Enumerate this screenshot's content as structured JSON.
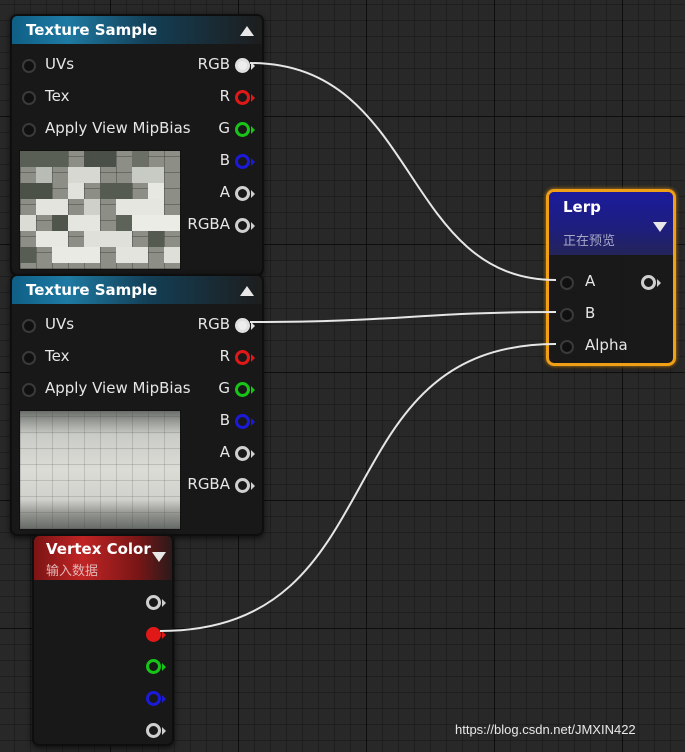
{
  "texture_sample_1": {
    "title": "Texture Sample",
    "inputs": [
      "UVs",
      "Tex",
      "Apply View MipBias"
    ],
    "outputs": [
      "RGB",
      "R",
      "G",
      "B",
      "A",
      "RGBA"
    ]
  },
  "texture_sample_2": {
    "title": "Texture Sample",
    "inputs": [
      "UVs",
      "Tex",
      "Apply View MipBias"
    ],
    "outputs": [
      "RGB",
      "R",
      "G",
      "B",
      "A",
      "RGBA"
    ]
  },
  "vertex_color": {
    "title": "Vertex Color",
    "subtitle": "输入数据"
  },
  "lerp": {
    "title": "Lerp",
    "subtitle": "正在预览",
    "inputs": [
      "A",
      "B",
      "Alpha"
    ]
  },
  "colors": {
    "pin_white": "#e0e0e0",
    "pin_red": "#e01818",
    "pin_green": "#18c418",
    "pin_blue": "#1a1ad8",
    "pin_gray": "#cfcfcf",
    "selection_orange": "#f0a017",
    "wire": "#e6e6e6"
  },
  "watermark": "https://blog.csdn.net/JMXIN422"
}
